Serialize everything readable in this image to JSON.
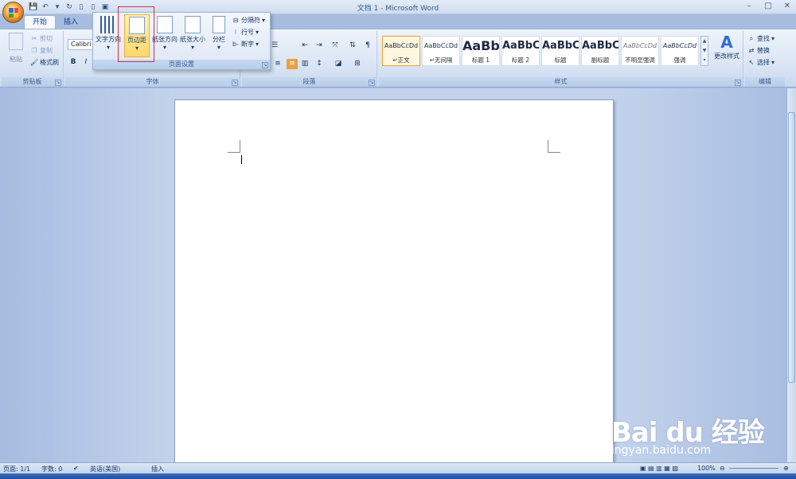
{
  "window": {
    "title": "文档 1 - Microsoft Word",
    "minimize": "–",
    "maximize": "□",
    "close": "✕"
  },
  "tabs": [
    {
      "label": "开始",
      "active": true
    },
    {
      "label": "插入",
      "active": false
    }
  ],
  "clipboard": {
    "paste_label": "粘贴",
    "cut_label": "剪切",
    "copy_label": "复制",
    "format_painter_label": "格式刷",
    "group_label": "剪贴板"
  },
  "font": {
    "font_name": "Calibri",
    "bold_label": "B",
    "italic_label": "I",
    "group_label": "字体"
  },
  "page_setup": {
    "text_direction_label": "文字方向",
    "margins_label": "页边距",
    "orientation_label": "纸张方向",
    "size_label": "纸张大小",
    "columns_label": "分栏",
    "breaks_label": "分隔符",
    "line_numbers_label": "行号",
    "hyphenation_label": "断字",
    "group_label": "页面设置"
  },
  "paragraph": {
    "group_label": "段落"
  },
  "styles": {
    "group_label": "样式",
    "items": [
      {
        "preview": "AaBbCcDd",
        "name": "↵正文"
      },
      {
        "preview": "AaBbCcDd",
        "name": "↵无间隔"
      },
      {
        "preview": "AaBb",
        "name": "标题 1"
      },
      {
        "preview": "AaBbC",
        "name": "标题 2"
      },
      {
        "preview": "AaBbC",
        "name": "标题"
      },
      {
        "preview": "AaBbC",
        "name": "副标题"
      },
      {
        "preview": "AaBbCcDd",
        "name": "不明显强调"
      },
      {
        "preview": "AaBbCcDd",
        "name": "强调"
      }
    ],
    "change_styles_label": "更改样式"
  },
  "editing": {
    "find_label": "查找",
    "replace_label": "替换",
    "select_label": "选择",
    "group_label": "编辑"
  },
  "status": {
    "page": "页面: 1/1",
    "words": "字数: 0",
    "language": "英语(美国)",
    "insert_mode": "插入",
    "zoom": "100%"
  },
  "watermark": {
    "logo_text": "Bai du 经验",
    "url": "jingyan.baidu.com"
  }
}
